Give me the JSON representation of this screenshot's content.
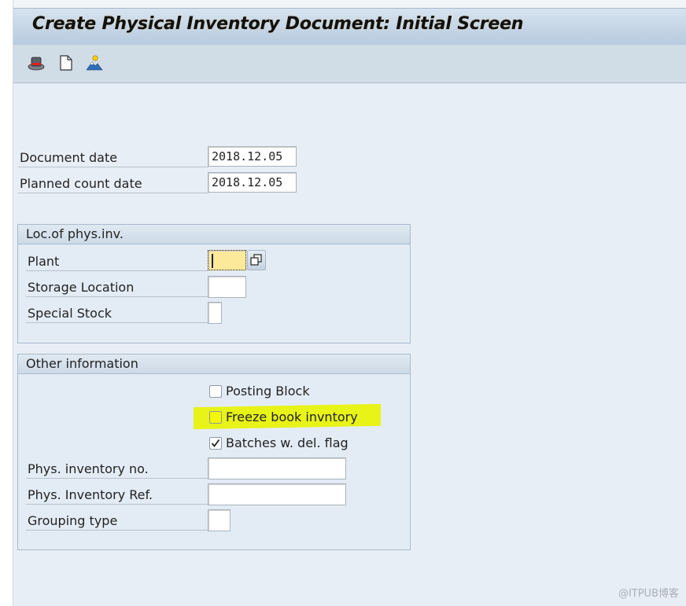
{
  "window": {
    "title": "Create Physical Inventory Document: Initial Screen"
  },
  "toolbar": {
    "buttons": [
      {
        "icon": "hat-icon",
        "tooltip": "Default values"
      },
      {
        "icon": "new-document-icon",
        "tooltip": "New document"
      },
      {
        "icon": "person-icon",
        "tooltip": "Personal settings"
      }
    ]
  },
  "header_fields": {
    "document_date": {
      "label": "Document date",
      "value": "2018.12.05"
    },
    "planned_count_date": {
      "label": "Planned count date",
      "value": "2018.12.05"
    }
  },
  "location_group": {
    "title": "Loc.of phys.inv.",
    "plant": {
      "label": "Plant",
      "value": ""
    },
    "storage_location": {
      "label": "Storage Location",
      "value": ""
    },
    "special_stock": {
      "label": "Special Stock",
      "value": ""
    }
  },
  "other_group": {
    "title": "Other information",
    "posting_block": {
      "label": "Posting Block",
      "checked": false
    },
    "freeze_book_inventory": {
      "label": "Freeze book invntory",
      "checked": false,
      "highlighted": true
    },
    "batches_del_flag": {
      "label": "Batches w. del. flag",
      "checked": true
    },
    "phys_inventory_no": {
      "label": "Phys. inventory no.",
      "value": ""
    },
    "phys_inventory_ref": {
      "label": "Phys. Inventory Ref.",
      "value": ""
    },
    "grouping_type": {
      "label": "Grouping type",
      "value": ""
    }
  },
  "colors": {
    "highlight": "#e8f400",
    "focus_field": "#fde99a",
    "background": "#e8eef5"
  },
  "watermark": "@ITPUB博客"
}
